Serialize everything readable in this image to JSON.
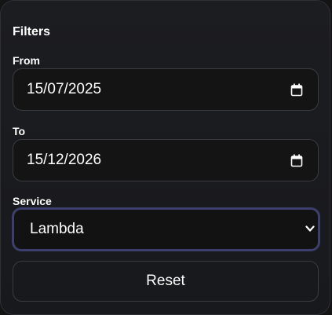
{
  "filters": {
    "title": "Filters",
    "from": {
      "label": "From",
      "value": "15/07/2025",
      "icon": "calendar-icon"
    },
    "to": {
      "label": "To",
      "value": "15/12/2026",
      "icon": "calendar-icon"
    },
    "service": {
      "label": "Service",
      "value": "Lambda",
      "icon": "chevron-down-icon"
    },
    "reset_label": "Reset"
  },
  "colors": {
    "background": "#18191c",
    "focus_border": "#3c3f6c",
    "field_border": "#3a3c41",
    "text": "#ffffff"
  }
}
